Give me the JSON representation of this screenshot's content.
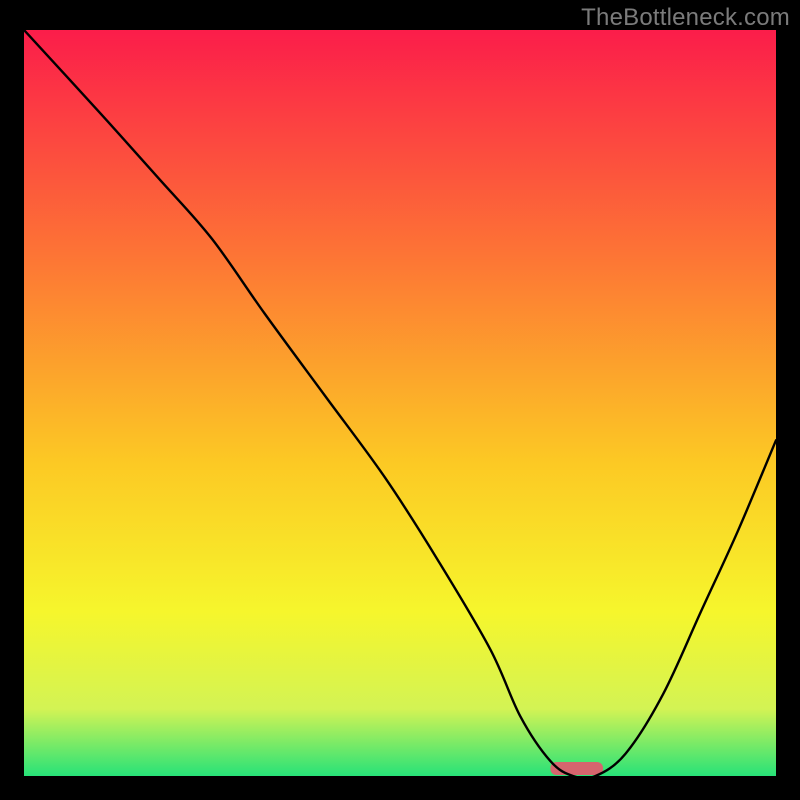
{
  "watermark": "TheBottleneck.com",
  "chart_data": {
    "type": "line",
    "title": "",
    "xlabel": "",
    "ylabel": "",
    "xlim": [
      0,
      100
    ],
    "ylim": [
      0,
      100
    ],
    "x": [
      0,
      10,
      18,
      25,
      32,
      40,
      48,
      55,
      62,
      66,
      70,
      73,
      76,
      80,
      85,
      90,
      95,
      100
    ],
    "values": [
      100,
      89,
      80,
      72,
      62,
      51,
      40,
      29,
      17,
      8,
      2,
      0,
      0,
      3,
      11,
      22,
      33,
      45
    ],
    "minimum_marker": {
      "x_start": 70,
      "x_end": 77,
      "color": "#d6656e"
    },
    "background_gradient": {
      "top": "#fb1d4a",
      "mid1": "#fd7435",
      "mid2": "#fcc924",
      "mid3": "#f6f62c",
      "mid4": "#d3f354",
      "bottom": "#27e278"
    }
  }
}
